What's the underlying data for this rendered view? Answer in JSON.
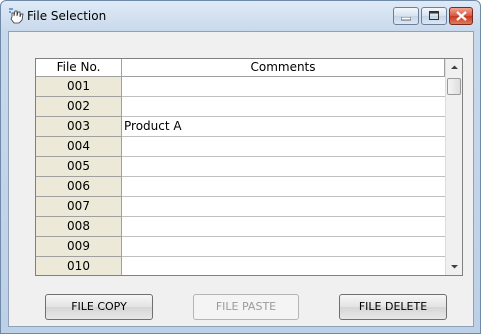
{
  "window": {
    "title": "File Selection",
    "icons": {
      "app": "hand-pointer-icon",
      "minimize": "minimize-icon",
      "maximize": "maximize-icon",
      "close": "close-icon"
    }
  },
  "table": {
    "headers": {
      "file_no": "File No.",
      "comments": "Comments"
    },
    "rows": [
      {
        "no": "001",
        "comment": ""
      },
      {
        "no": "002",
        "comment": ""
      },
      {
        "no": "003",
        "comment": "Product A"
      },
      {
        "no": "004",
        "comment": ""
      },
      {
        "no": "005",
        "comment": ""
      },
      {
        "no": "006",
        "comment": ""
      },
      {
        "no": "007",
        "comment": ""
      },
      {
        "no": "008",
        "comment": ""
      },
      {
        "no": "009",
        "comment": ""
      },
      {
        "no": "010",
        "comment": ""
      }
    ],
    "scroll": {
      "up_icon": "scroll-up-arrow-icon",
      "down_icon": "scroll-down-arrow-icon"
    }
  },
  "buttons": {
    "copy": "FILE COPY",
    "paste": "FILE PASTE",
    "delete": "FILE DELETE"
  },
  "colors": {
    "close_button": "#c53a22",
    "header_cell": "#ece9d8",
    "disabled_text": "#9b9b9b"
  }
}
